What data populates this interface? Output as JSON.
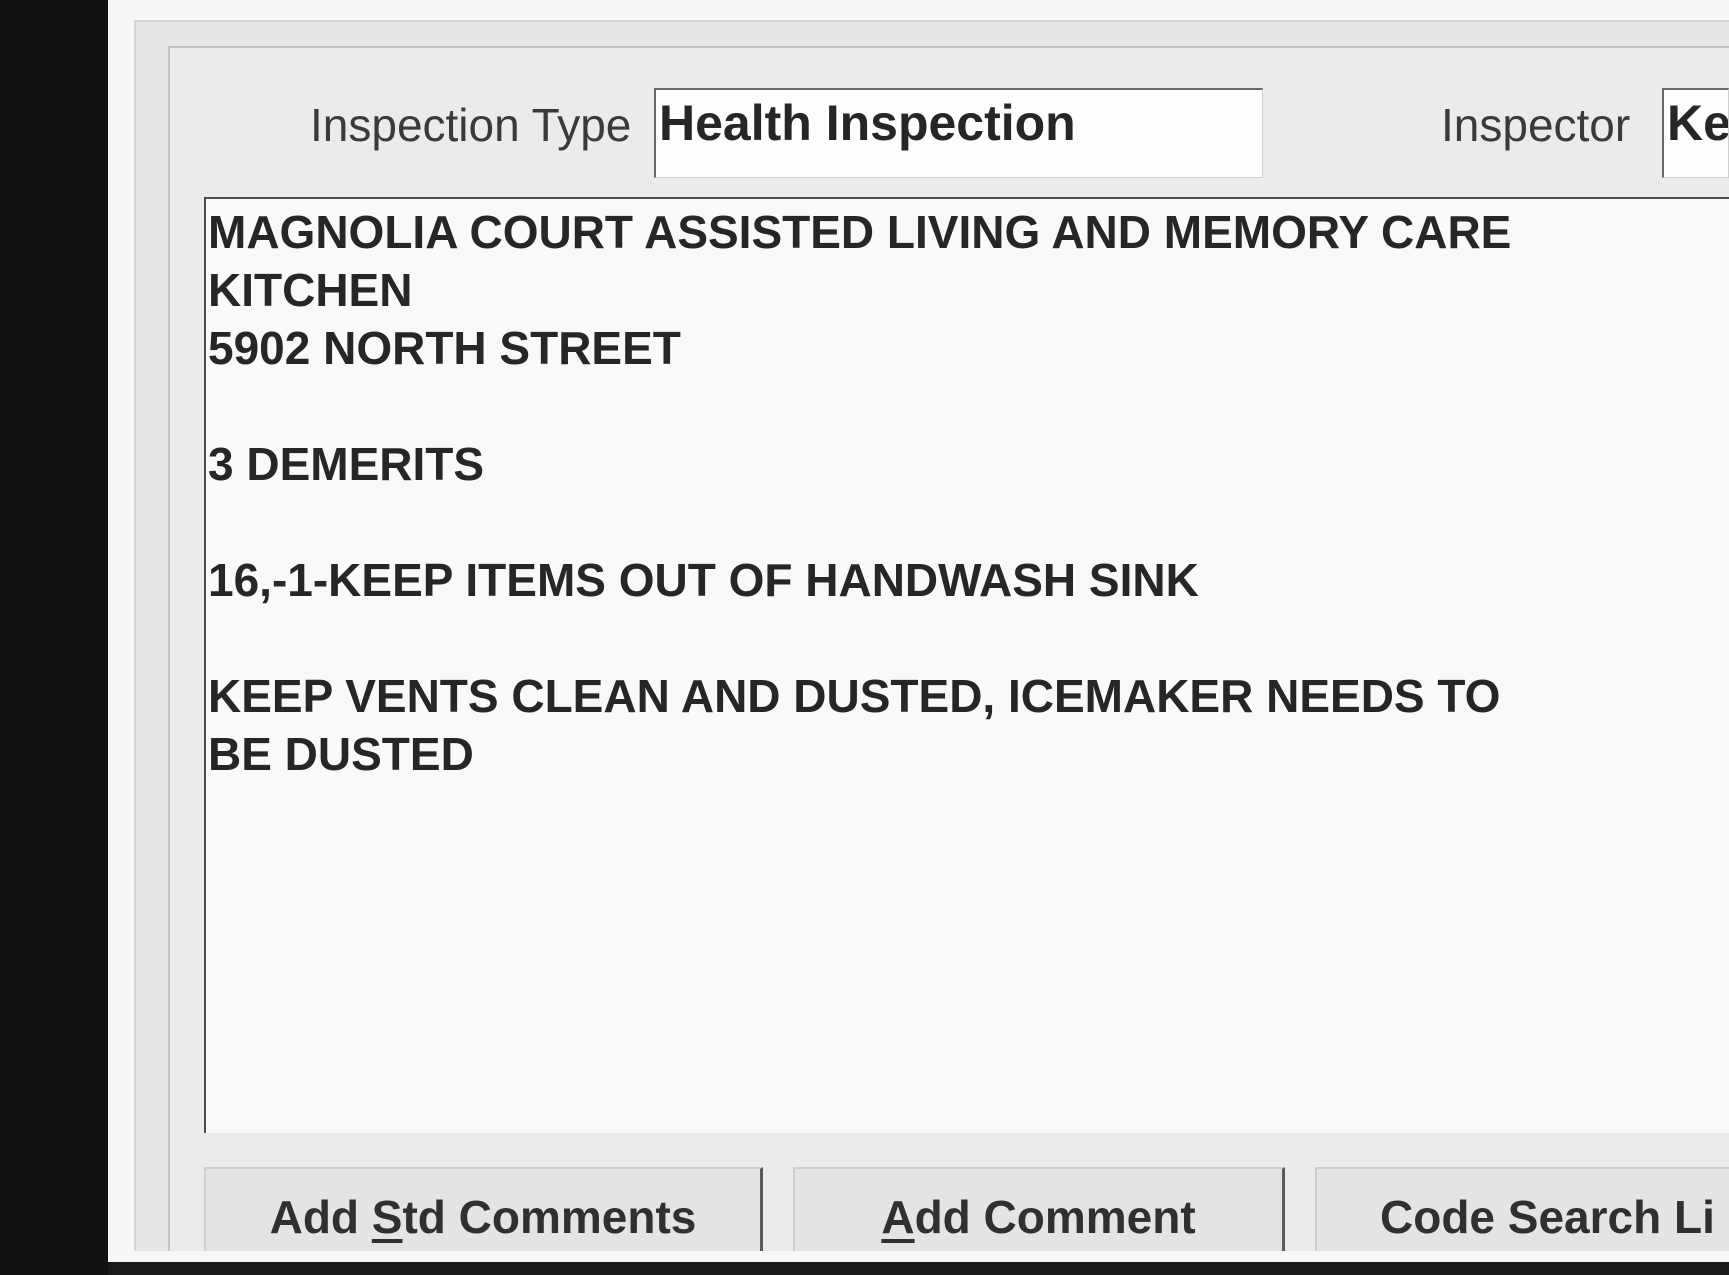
{
  "header": {
    "inspection_type_label": "Inspection Type",
    "inspection_type_value": "Health Inspection",
    "inspector_label": "Inspector",
    "inspector_value": "Ke"
  },
  "comments": {
    "text": "MAGNOLIA COURT ASSISTED LIVING AND MEMORY CARE\nKITCHEN\n5902 NORTH STREET\n\n3 DEMERITS\n\n16,-1-KEEP ITEMS OUT OF HANDWASH SINK\n\nKEEP VENTS CLEAN AND DUSTED, ICEMAKER NEEDS TO\nBE DUSTED"
  },
  "buttons": {
    "add_std_comments": {
      "before": "Add ",
      "mnemonic": "S",
      "after": "td Comments"
    },
    "add_comment": {
      "mnemonic": "A",
      "after": "dd Comment"
    },
    "code_search": {
      "label": "Code Search Li"
    }
  }
}
